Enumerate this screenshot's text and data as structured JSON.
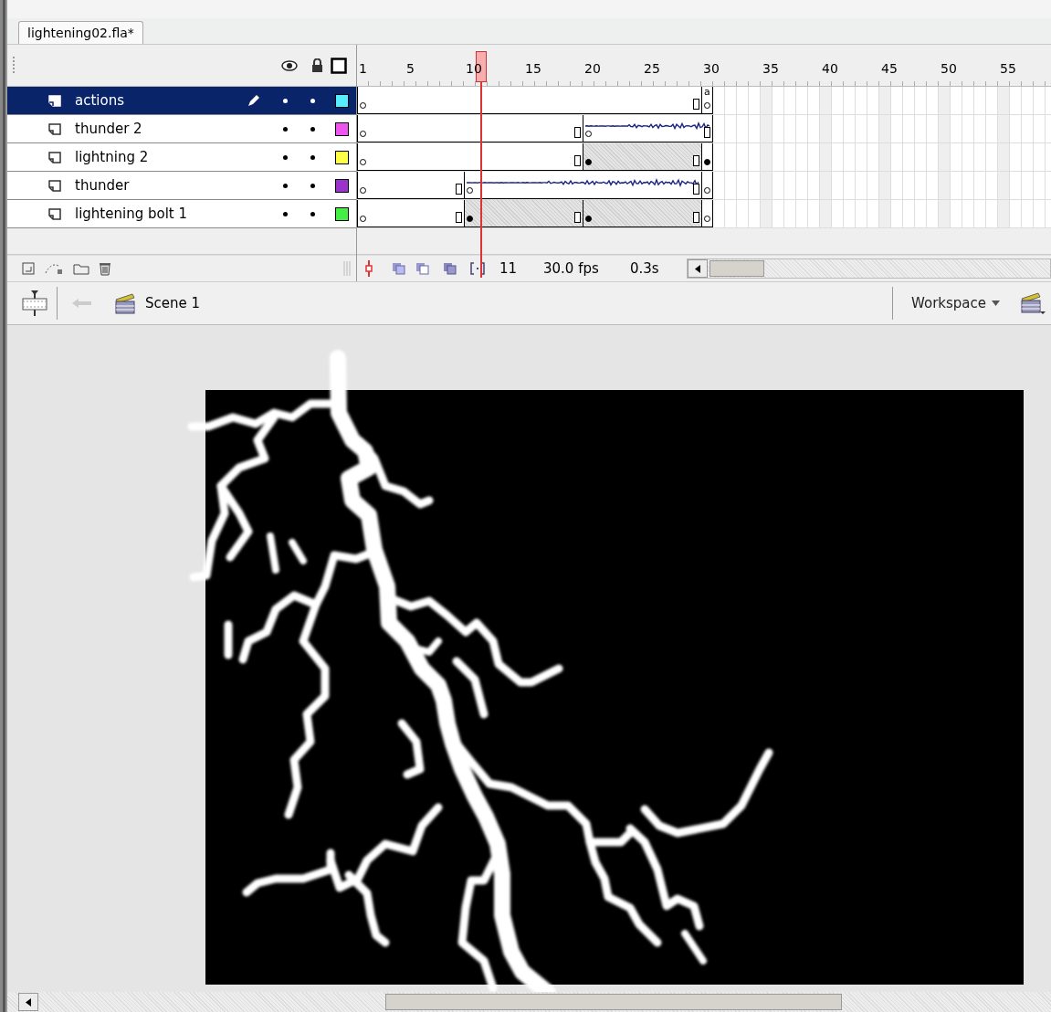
{
  "document_tab": {
    "title": "lightening02.fla*",
    "selected": true
  },
  "ruler": {
    "labels": [
      "1",
      "5",
      "10",
      "15",
      "20",
      "25",
      "30",
      "35",
      "40",
      "45",
      "50",
      "55"
    ]
  },
  "layers": [
    {
      "name": "actions",
      "selected": true,
      "editing": true,
      "color": "#55eeff",
      "spans": [
        {
          "filled": false,
          "sound": false
        },
        {
          "filled": false,
          "sound": false,
          "label": "a"
        }
      ]
    },
    {
      "name": "thunder 2",
      "selected": false,
      "editing": false,
      "color": "#ee55ee",
      "spans": [
        {
          "filled": false,
          "sound": false
        },
        {
          "filled": false,
          "sound": true
        }
      ]
    },
    {
      "name": "lightning 2",
      "selected": false,
      "editing": false,
      "color": "#ffff44",
      "spans": [
        {
          "filled": false,
          "sound": false
        },
        {
          "filled": true,
          "sound": false
        },
        {
          "filled": true,
          "sound": false
        }
      ]
    },
    {
      "name": "thunder",
      "selected": false,
      "editing": false,
      "color": "#9933cc",
      "spans": [
        {
          "filled": false,
          "sound": false
        },
        {
          "filled": false,
          "sound": true
        },
        {
          "filled": false,
          "sound": false
        }
      ]
    },
    {
      "name": "lightening bolt 1",
      "selected": false,
      "editing": false,
      "color": "#44ee44",
      "spans": [
        {
          "filled": false,
          "sound": false
        },
        {
          "filled": true,
          "sound": false
        },
        {
          "filled": true,
          "sound": false
        },
        {
          "filled": false,
          "sound": false
        }
      ]
    }
  ],
  "status": {
    "current_frame": "11",
    "frame_rate": "30.0 fps",
    "elapsed": "0.3s"
  },
  "edit_bar": {
    "scene": "Scene 1",
    "workspace": "Workspace"
  }
}
